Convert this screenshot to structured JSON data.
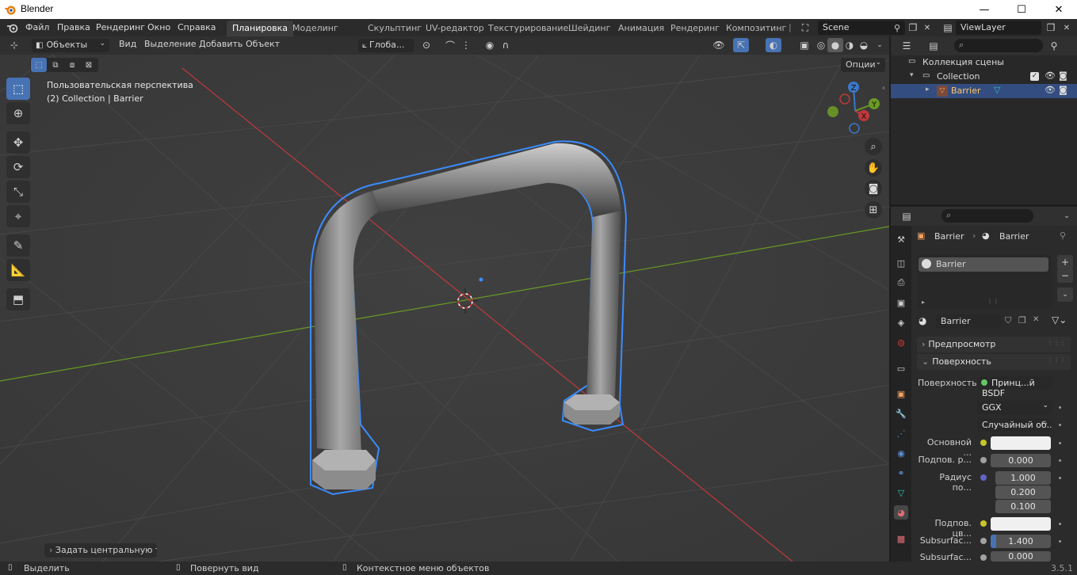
{
  "window": {
    "title": "Blender",
    "minimize": "—",
    "maximize": "☐",
    "close": "✕"
  },
  "menu": {
    "items": [
      "Файл",
      "Правка",
      "Рендеринг",
      "Окно",
      "Справка"
    ],
    "workspaces": [
      "Планировка",
      "Моделинг",
      "Скульптинг",
      "UV-редактор",
      "Текстурирование",
      "Шейдинг",
      "Анимация",
      "Рендеринг",
      "Композитинг"
    ],
    "active_workspace": "Планировка",
    "scene_name": "Scene",
    "view_layer": "ViewLayer"
  },
  "viewport_header": {
    "mode": "Объекты",
    "view": "Вид",
    "select": "Выделение",
    "add": "Добавить",
    "object": "Объект",
    "orientation": "Глоба...",
    "options": "Опции"
  },
  "viewport": {
    "perspective_label": "Пользовательская перспектива",
    "collection_label": "(2) Collection | Barrier",
    "last_operator": "Задать центральную точк",
    "gizmo": {
      "z": "Z",
      "y": "Y",
      "x": "X"
    }
  },
  "outliner": {
    "scene_collection": "Коллекция сцены",
    "collection": "Collection",
    "object": "Barrier"
  },
  "properties": {
    "breadcrumb_object": "Barrier",
    "breadcrumb_material": "Barrier",
    "material_slot": "Barrier",
    "material_name": "Barrier",
    "panel_preview": "Предпросмотр",
    "panel_surface": "Поверхность",
    "surface_label": "Поверхность",
    "surface_value": "Принц...й BSDF",
    "distribution": "GGX",
    "subsurface_method": "Случайный об...",
    "base_color_label": "Основной ...",
    "subsurface_label": "Подпов. р...",
    "subsurface_value": "0.000",
    "subsurface_radius_label": "Радиус по...",
    "radius_values": [
      "1.000",
      "0.200",
      "0.100"
    ],
    "subsurface_color_label": "Подпов. цв...",
    "subsurface_ior_label": "Subsurfac...",
    "subsurface_ior_value": "1.400",
    "subsurface_aniso_label": "Subsurfac...",
    "subsurface_aniso_value": "0.000"
  },
  "statusbar": {
    "select": "Выделить",
    "rotate_view": "Повернуть вид",
    "context_menu": "Контекстное меню объектов",
    "version": "3.5.1"
  },
  "colors": {
    "accent": "#4772b3",
    "selection_outline": "#3b8cff",
    "x_axis": "#c0393b",
    "y_axis": "#6a9a23",
    "viewport_bg": "#3a3a3a"
  }
}
